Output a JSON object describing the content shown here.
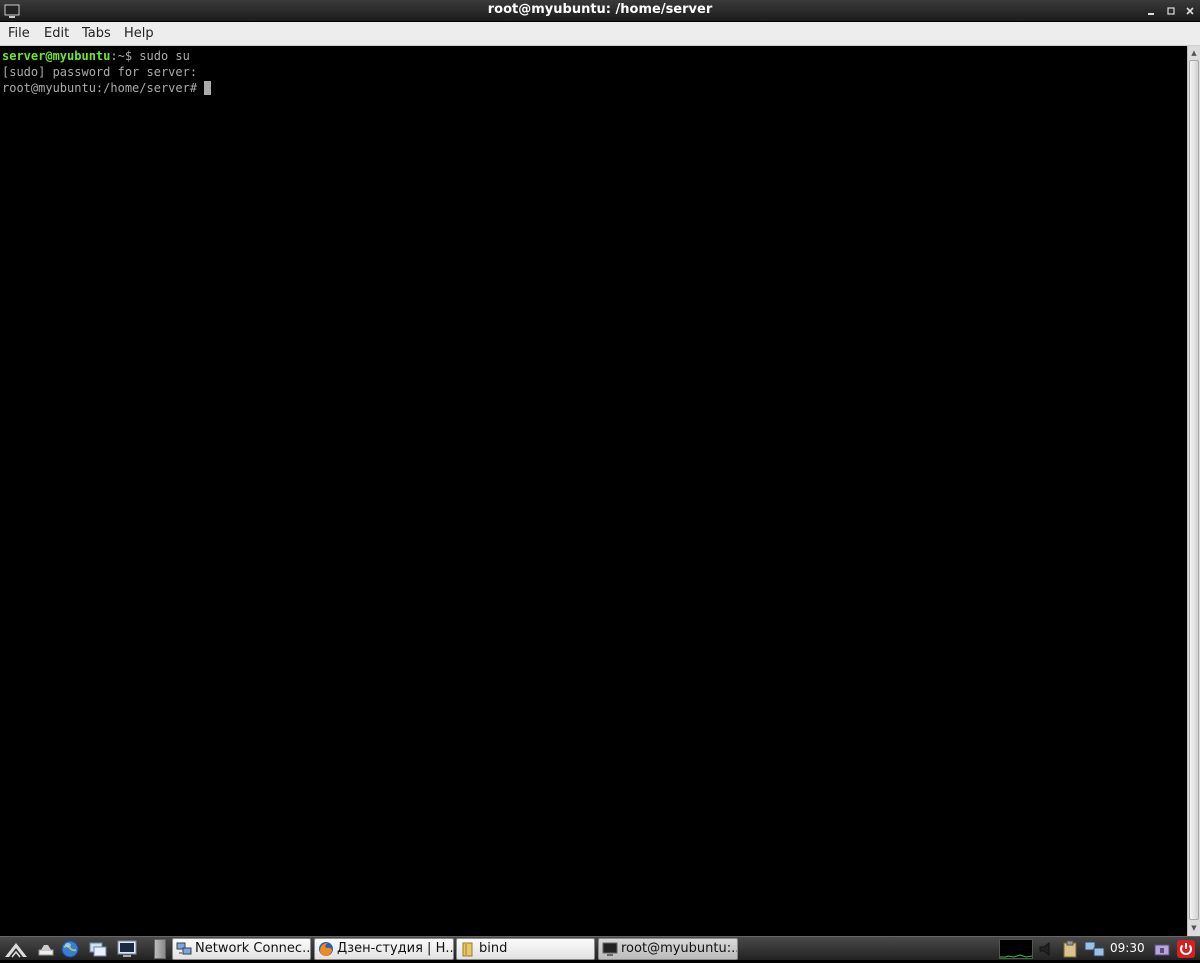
{
  "window": {
    "title": "root@myubuntu: /home/server",
    "icon": "terminal-icon",
    "controls": [
      "minimize",
      "maximize",
      "close"
    ]
  },
  "menu": {
    "items": [
      "File",
      "Edit",
      "Tabs",
      "Help"
    ]
  },
  "terminal": {
    "line1_user": "server@myubuntu",
    "line1_rest": ":~$ sudo su",
    "line2": "[sudo] password for server:",
    "line3": "root@myubuntu:/home/server#"
  },
  "taskbar": {
    "launchers": [
      "lxde-menu-icon",
      "show-desktop-icon",
      "web-browser-icon",
      "file-manager-icon",
      "terminal-icon"
    ],
    "tasks": [
      {
        "label": "Network Connec...",
        "icon": "network-connections-icon",
        "active": false
      },
      {
        "label": "Дзен-студия | Н...",
        "icon": "firefox-icon",
        "active": false
      },
      {
        "label": "bind",
        "icon": "folder-icon",
        "active": false
      },
      {
        "label": "root@myubuntu:...",
        "icon": "terminal-icon",
        "active": true
      }
    ],
    "tray": [
      "cpu-monitor",
      "volume-icon",
      "clipboard-icon",
      "network-icon"
    ],
    "clock": "09:30",
    "colors": {
      "prompt_user": "#6fe52e",
      "terminal_text": "#aaaaaa",
      "terminal_bg": "#000000"
    }
  }
}
